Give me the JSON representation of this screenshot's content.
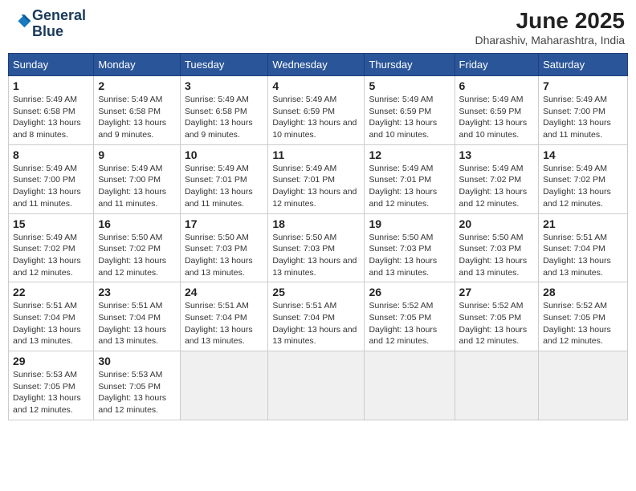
{
  "header": {
    "logo_line1": "General",
    "logo_line2": "Blue",
    "month": "June 2025",
    "location": "Dharashiv, Maharashtra, India"
  },
  "days_of_week": [
    "Sunday",
    "Monday",
    "Tuesday",
    "Wednesday",
    "Thursday",
    "Friday",
    "Saturday"
  ],
  "weeks": [
    [
      {
        "day": 1,
        "info": "Sunrise: 5:49 AM\nSunset: 6:58 PM\nDaylight: 13 hours and 8 minutes."
      },
      {
        "day": 2,
        "info": "Sunrise: 5:49 AM\nSunset: 6:58 PM\nDaylight: 13 hours and 9 minutes."
      },
      {
        "day": 3,
        "info": "Sunrise: 5:49 AM\nSunset: 6:58 PM\nDaylight: 13 hours and 9 minutes."
      },
      {
        "day": 4,
        "info": "Sunrise: 5:49 AM\nSunset: 6:59 PM\nDaylight: 13 hours and 10 minutes."
      },
      {
        "day": 5,
        "info": "Sunrise: 5:49 AM\nSunset: 6:59 PM\nDaylight: 13 hours and 10 minutes."
      },
      {
        "day": 6,
        "info": "Sunrise: 5:49 AM\nSunset: 6:59 PM\nDaylight: 13 hours and 10 minutes."
      },
      {
        "day": 7,
        "info": "Sunrise: 5:49 AM\nSunset: 7:00 PM\nDaylight: 13 hours and 11 minutes."
      }
    ],
    [
      {
        "day": 8,
        "info": "Sunrise: 5:49 AM\nSunset: 7:00 PM\nDaylight: 13 hours and 11 minutes."
      },
      {
        "day": 9,
        "info": "Sunrise: 5:49 AM\nSunset: 7:00 PM\nDaylight: 13 hours and 11 minutes."
      },
      {
        "day": 10,
        "info": "Sunrise: 5:49 AM\nSunset: 7:01 PM\nDaylight: 13 hours and 11 minutes."
      },
      {
        "day": 11,
        "info": "Sunrise: 5:49 AM\nSunset: 7:01 PM\nDaylight: 13 hours and 12 minutes."
      },
      {
        "day": 12,
        "info": "Sunrise: 5:49 AM\nSunset: 7:01 PM\nDaylight: 13 hours and 12 minutes."
      },
      {
        "day": 13,
        "info": "Sunrise: 5:49 AM\nSunset: 7:02 PM\nDaylight: 13 hours and 12 minutes."
      },
      {
        "day": 14,
        "info": "Sunrise: 5:49 AM\nSunset: 7:02 PM\nDaylight: 13 hours and 12 minutes."
      }
    ],
    [
      {
        "day": 15,
        "info": "Sunrise: 5:49 AM\nSunset: 7:02 PM\nDaylight: 13 hours and 12 minutes."
      },
      {
        "day": 16,
        "info": "Sunrise: 5:50 AM\nSunset: 7:02 PM\nDaylight: 13 hours and 12 minutes."
      },
      {
        "day": 17,
        "info": "Sunrise: 5:50 AM\nSunset: 7:03 PM\nDaylight: 13 hours and 13 minutes."
      },
      {
        "day": 18,
        "info": "Sunrise: 5:50 AM\nSunset: 7:03 PM\nDaylight: 13 hours and 13 minutes."
      },
      {
        "day": 19,
        "info": "Sunrise: 5:50 AM\nSunset: 7:03 PM\nDaylight: 13 hours and 13 minutes."
      },
      {
        "day": 20,
        "info": "Sunrise: 5:50 AM\nSunset: 7:03 PM\nDaylight: 13 hours and 13 minutes."
      },
      {
        "day": 21,
        "info": "Sunrise: 5:51 AM\nSunset: 7:04 PM\nDaylight: 13 hours and 13 minutes."
      }
    ],
    [
      {
        "day": 22,
        "info": "Sunrise: 5:51 AM\nSunset: 7:04 PM\nDaylight: 13 hours and 13 minutes."
      },
      {
        "day": 23,
        "info": "Sunrise: 5:51 AM\nSunset: 7:04 PM\nDaylight: 13 hours and 13 minutes."
      },
      {
        "day": 24,
        "info": "Sunrise: 5:51 AM\nSunset: 7:04 PM\nDaylight: 13 hours and 13 minutes."
      },
      {
        "day": 25,
        "info": "Sunrise: 5:51 AM\nSunset: 7:04 PM\nDaylight: 13 hours and 13 minutes."
      },
      {
        "day": 26,
        "info": "Sunrise: 5:52 AM\nSunset: 7:05 PM\nDaylight: 13 hours and 12 minutes."
      },
      {
        "day": 27,
        "info": "Sunrise: 5:52 AM\nSunset: 7:05 PM\nDaylight: 13 hours and 12 minutes."
      },
      {
        "day": 28,
        "info": "Sunrise: 5:52 AM\nSunset: 7:05 PM\nDaylight: 13 hours and 12 minutes."
      }
    ],
    [
      {
        "day": 29,
        "info": "Sunrise: 5:53 AM\nSunset: 7:05 PM\nDaylight: 13 hours and 12 minutes."
      },
      {
        "day": 30,
        "info": "Sunrise: 5:53 AM\nSunset: 7:05 PM\nDaylight: 13 hours and 12 minutes."
      },
      {
        "day": null,
        "info": ""
      },
      {
        "day": null,
        "info": ""
      },
      {
        "day": null,
        "info": ""
      },
      {
        "day": null,
        "info": ""
      },
      {
        "day": null,
        "info": ""
      }
    ]
  ]
}
